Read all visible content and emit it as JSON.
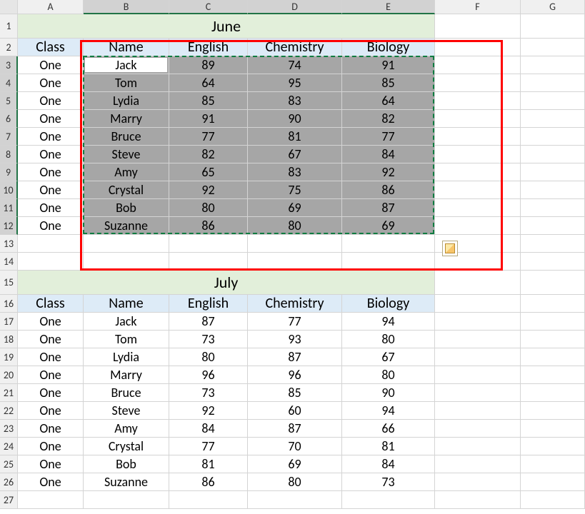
{
  "columns": [
    "A",
    "B",
    "C",
    "D",
    "E",
    "F",
    "G"
  ],
  "row_count": 27,
  "tables": {
    "june": {
      "title": "June",
      "headers": [
        "Class",
        "Name",
        "English",
        "Chemistry",
        "Biology"
      ],
      "rows": [
        [
          "One",
          "Jack",
          "89",
          "74",
          "91"
        ],
        [
          "One",
          "Tom",
          "64",
          "95",
          "85"
        ],
        [
          "One",
          "Lydia",
          "85",
          "83",
          "64"
        ],
        [
          "One",
          "Marry",
          "91",
          "90",
          "82"
        ],
        [
          "One",
          "Bruce",
          "77",
          "81",
          "77"
        ],
        [
          "One",
          "Steve",
          "82",
          "67",
          "84"
        ],
        [
          "One",
          "Amy",
          "65",
          "83",
          "92"
        ],
        [
          "One",
          "Crystal",
          "92",
          "75",
          "86"
        ],
        [
          "One",
          "Bob",
          "80",
          "69",
          "87"
        ],
        [
          "One",
          "Suzanne",
          "86",
          "80",
          "69"
        ]
      ]
    },
    "july": {
      "title": "July",
      "headers": [
        "Class",
        "Name",
        "English",
        "Chemistry",
        "Biology"
      ],
      "rows": [
        [
          "One",
          "Jack",
          "87",
          "77",
          "94"
        ],
        [
          "One",
          "Tom",
          "73",
          "93",
          "80"
        ],
        [
          "One",
          "Lydia",
          "80",
          "87",
          "67"
        ],
        [
          "One",
          "Marry",
          "96",
          "96",
          "80"
        ],
        [
          "One",
          "Bruce",
          "73",
          "85",
          "90"
        ],
        [
          "One",
          "Steve",
          "92",
          "60",
          "94"
        ],
        [
          "One",
          "Amy",
          "84",
          "87",
          "66"
        ],
        [
          "One",
          "Crystal",
          "77",
          "70",
          "81"
        ],
        [
          "One",
          "Bob",
          "81",
          "69",
          "84"
        ],
        [
          "One",
          "Suzanne",
          "86",
          "80",
          "73"
        ]
      ]
    }
  },
  "selection": {
    "active_cell": "B3",
    "marquee_range": "B3:E12",
    "highlighted_columns": [
      "B",
      "C",
      "D",
      "E"
    ],
    "highlighted_rows": [
      3,
      4,
      5,
      6,
      7,
      8,
      9,
      10,
      11,
      12
    ]
  },
  "redbox_range": "B2:E14",
  "paste_options_icon": true
}
